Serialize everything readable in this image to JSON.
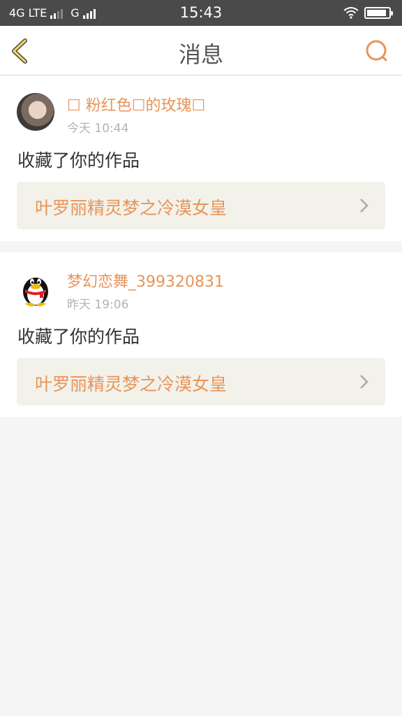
{
  "status_bar": {
    "network_left": "4G LTE",
    "network_right": "G",
    "time": "15:43",
    "wifi_icon": "wifi-icon",
    "battery_icon": "battery-icon"
  },
  "header": {
    "title": "消息",
    "back_icon": "back-icon",
    "search_icon": "search-icon",
    "accent_color": "#e8945a"
  },
  "messages": [
    {
      "username": "☐ 粉红色☐的玫瑰☐",
      "time": "今天 10:44",
      "action": "收藏了你的作品",
      "work_title": "叶罗丽精灵梦之冷漠女皇"
    },
    {
      "username": "梦幻恋舞_399320831",
      "time": "昨天 19:06",
      "action": "收藏了你的作品",
      "work_title": "叶罗丽精灵梦之冷漠女皇"
    }
  ]
}
